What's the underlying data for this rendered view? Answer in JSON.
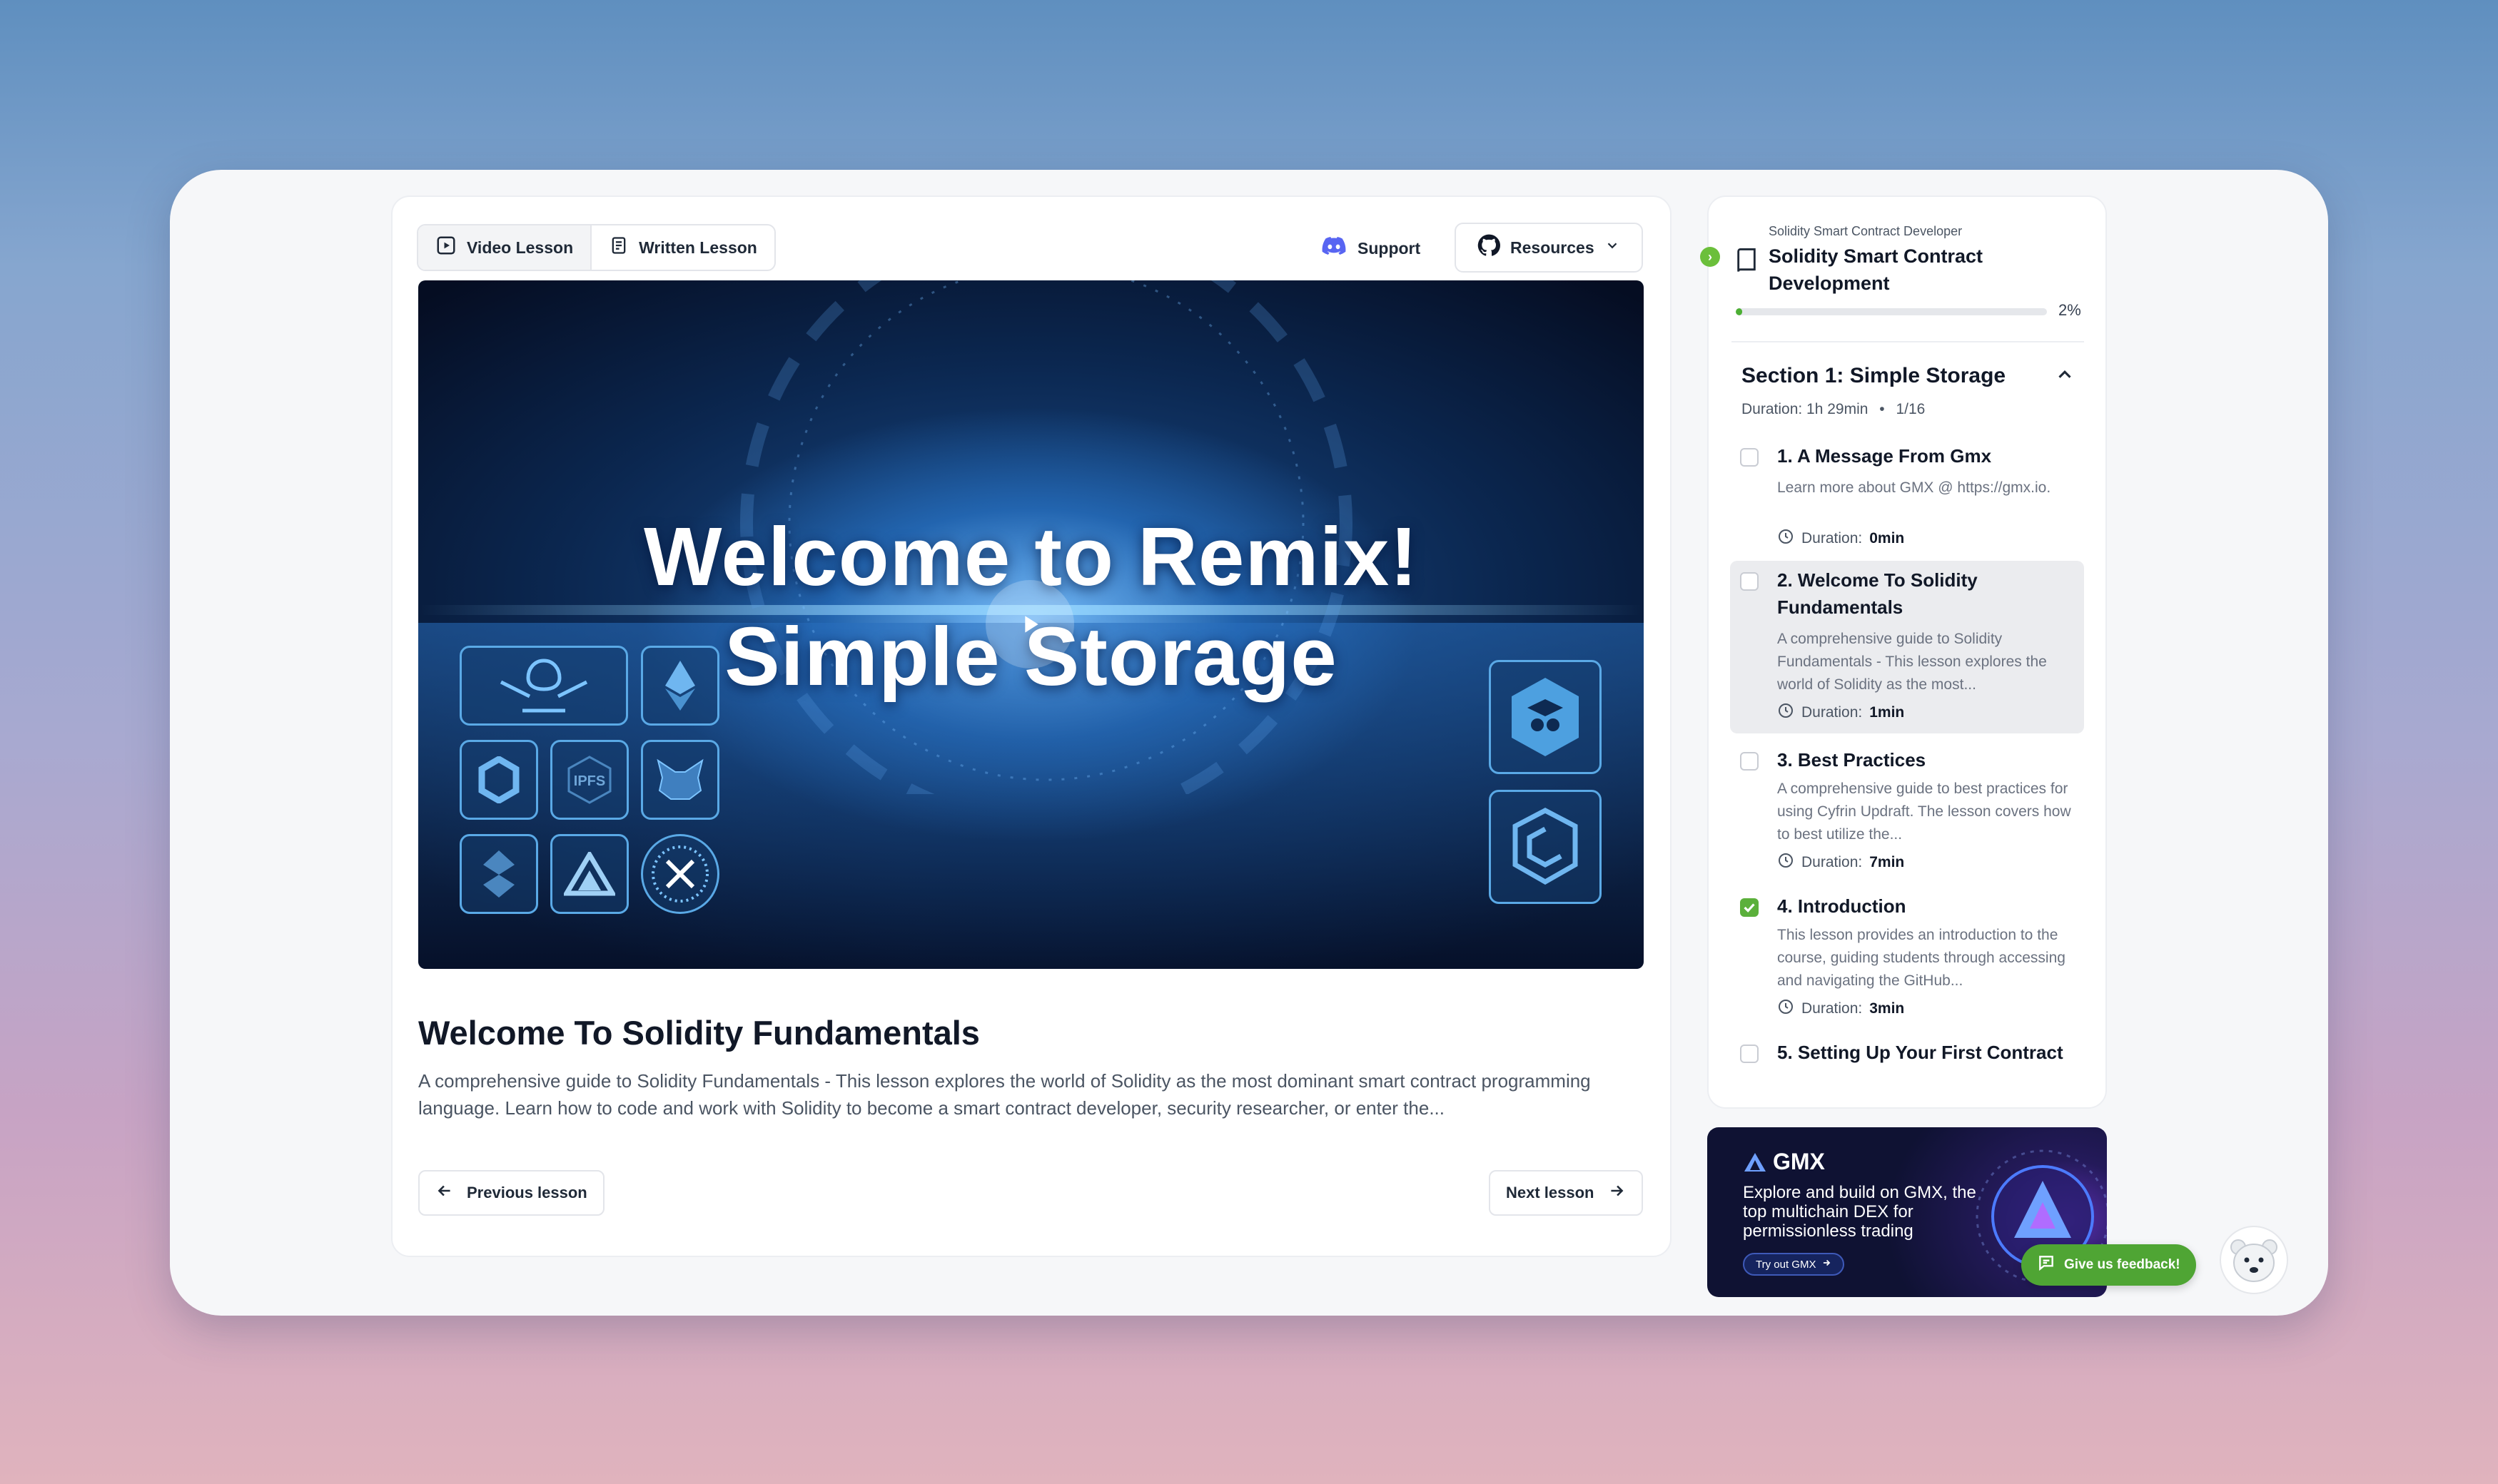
{
  "tabs": [
    {
      "label": "Video Lesson",
      "icon": "play-square-icon"
    },
    {
      "label": "Written Lesson",
      "icon": "document-icon"
    }
  ],
  "header": {
    "support_label": "Support",
    "resources_label": "Resources"
  },
  "video": {
    "title_line1": "Welcome to Remix!",
    "title_line2": "Simple Storage"
  },
  "lesson": {
    "title": "Welcome To Solidity Fundamentals",
    "description": "A comprehensive guide to Solidity Fundamentals - This lesson explores the world of Solidity as the most dominant smart contract programming language. Learn how to code and work with Solidity to become a smart contract developer, security researcher, or enter the..."
  },
  "nav": {
    "previous_label": "Previous lesson",
    "next_label": "Next lesson"
  },
  "course": {
    "supertitle": "Solidity Smart Contract Developer",
    "title": "Solidity Smart Contract Development",
    "progress_label": "2%",
    "progress_value": 0.02
  },
  "section": {
    "title": "Section 1: Simple Storage",
    "duration_label": "Duration: 1h 29min",
    "bullet": "•",
    "count": "1/16"
  },
  "lessons": [
    {
      "title": "1. A Message From Gmx",
      "desc": "Learn more about GMX @ https://gmx.io.",
      "dur_label": "Duration:",
      "dur": "0min",
      "done": false,
      "active": false
    },
    {
      "title": "2. Welcome To Solidity Fundamentals",
      "desc": "A comprehensive guide to Solidity Fundamentals - This lesson explores the world of Solidity as the most...",
      "dur_label": "Duration:",
      "dur": "1min",
      "done": false,
      "active": true
    },
    {
      "title": "3. Best Practices",
      "desc": "A comprehensive guide to best practices for using Cyfrin Updraft. The lesson covers how to best utilize the...",
      "dur_label": "Duration:",
      "dur": "7min",
      "done": false,
      "active": false
    },
    {
      "title": "4. Introduction",
      "desc": "This lesson provides an introduction to the course, guiding students through accessing and navigating the GitHub...",
      "dur_label": "Duration:",
      "dur": "3min",
      "done": true,
      "active": false
    },
    {
      "title": "5. Setting Up Your First Contract",
      "done": false,
      "active": false
    }
  ],
  "ad": {
    "brand": "GMX",
    "text": "Explore and build on GMX, the top multichain DEX for permissionless trading",
    "cta": "Try out GMX"
  },
  "feedback": {
    "label": "Give us feedback!"
  },
  "colors": {
    "accent_green": "#4fa534",
    "progress_green": "#4caf34",
    "discord_purple": "#5865f2"
  }
}
